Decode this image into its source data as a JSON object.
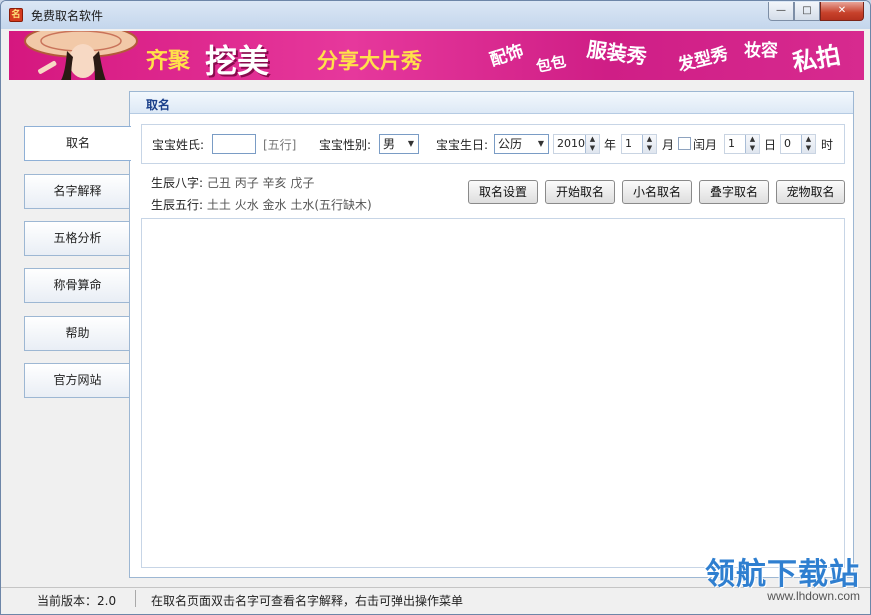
{
  "window": {
    "title": "免费取名软件",
    "minimize": "—",
    "maximize": "□",
    "close": "✕"
  },
  "banner": {
    "words": [
      "齐聚",
      "挖美",
      "分享大片秀",
      "配饰",
      "包包",
      "服装秀",
      "发型秀",
      "妆容",
      "私拍"
    ]
  },
  "sidebar": {
    "items": [
      {
        "label": "取名",
        "active": true
      },
      {
        "label": "名字解释"
      },
      {
        "label": "五格分析"
      },
      {
        "label": "称骨算命"
      },
      {
        "label": "帮助"
      },
      {
        "label": "官方网站"
      }
    ]
  },
  "main": {
    "header": "取名",
    "form": {
      "surname_label": "宝宝姓氏:",
      "surname_value": "",
      "wuxing_hint": "[五行]",
      "gender_label": "宝宝性别:",
      "gender_value": "男",
      "birthday_label": "宝宝生日:",
      "calendar_value": "公历",
      "year_value": "2010",
      "year_unit": "年",
      "month_value": "1",
      "month_unit": "月",
      "leap_label": "闰月",
      "day_value": "1",
      "day_unit": "日",
      "hour_value": "0",
      "hour_unit": "时"
    },
    "info": {
      "bazi_label": "生辰八字:",
      "bazi_value": "己丑 丙子 辛亥 戊子",
      "wuxing_label": "生辰五行:",
      "wuxing_value": "土土 火水 金水 土水(五行缺木)"
    },
    "buttons": {
      "settings": "取名设置",
      "start": "开始取名",
      "nickname": "小名取名",
      "double": "叠字取名",
      "pet": "宠物取名"
    }
  },
  "status": {
    "version": "当前版本：2.0",
    "hint": "在取名页面双击名字可查看名字解释，右击可弹出操作菜单"
  },
  "watermark": {
    "main": "领航下载站",
    "sub": "www.lhdown.com"
  }
}
